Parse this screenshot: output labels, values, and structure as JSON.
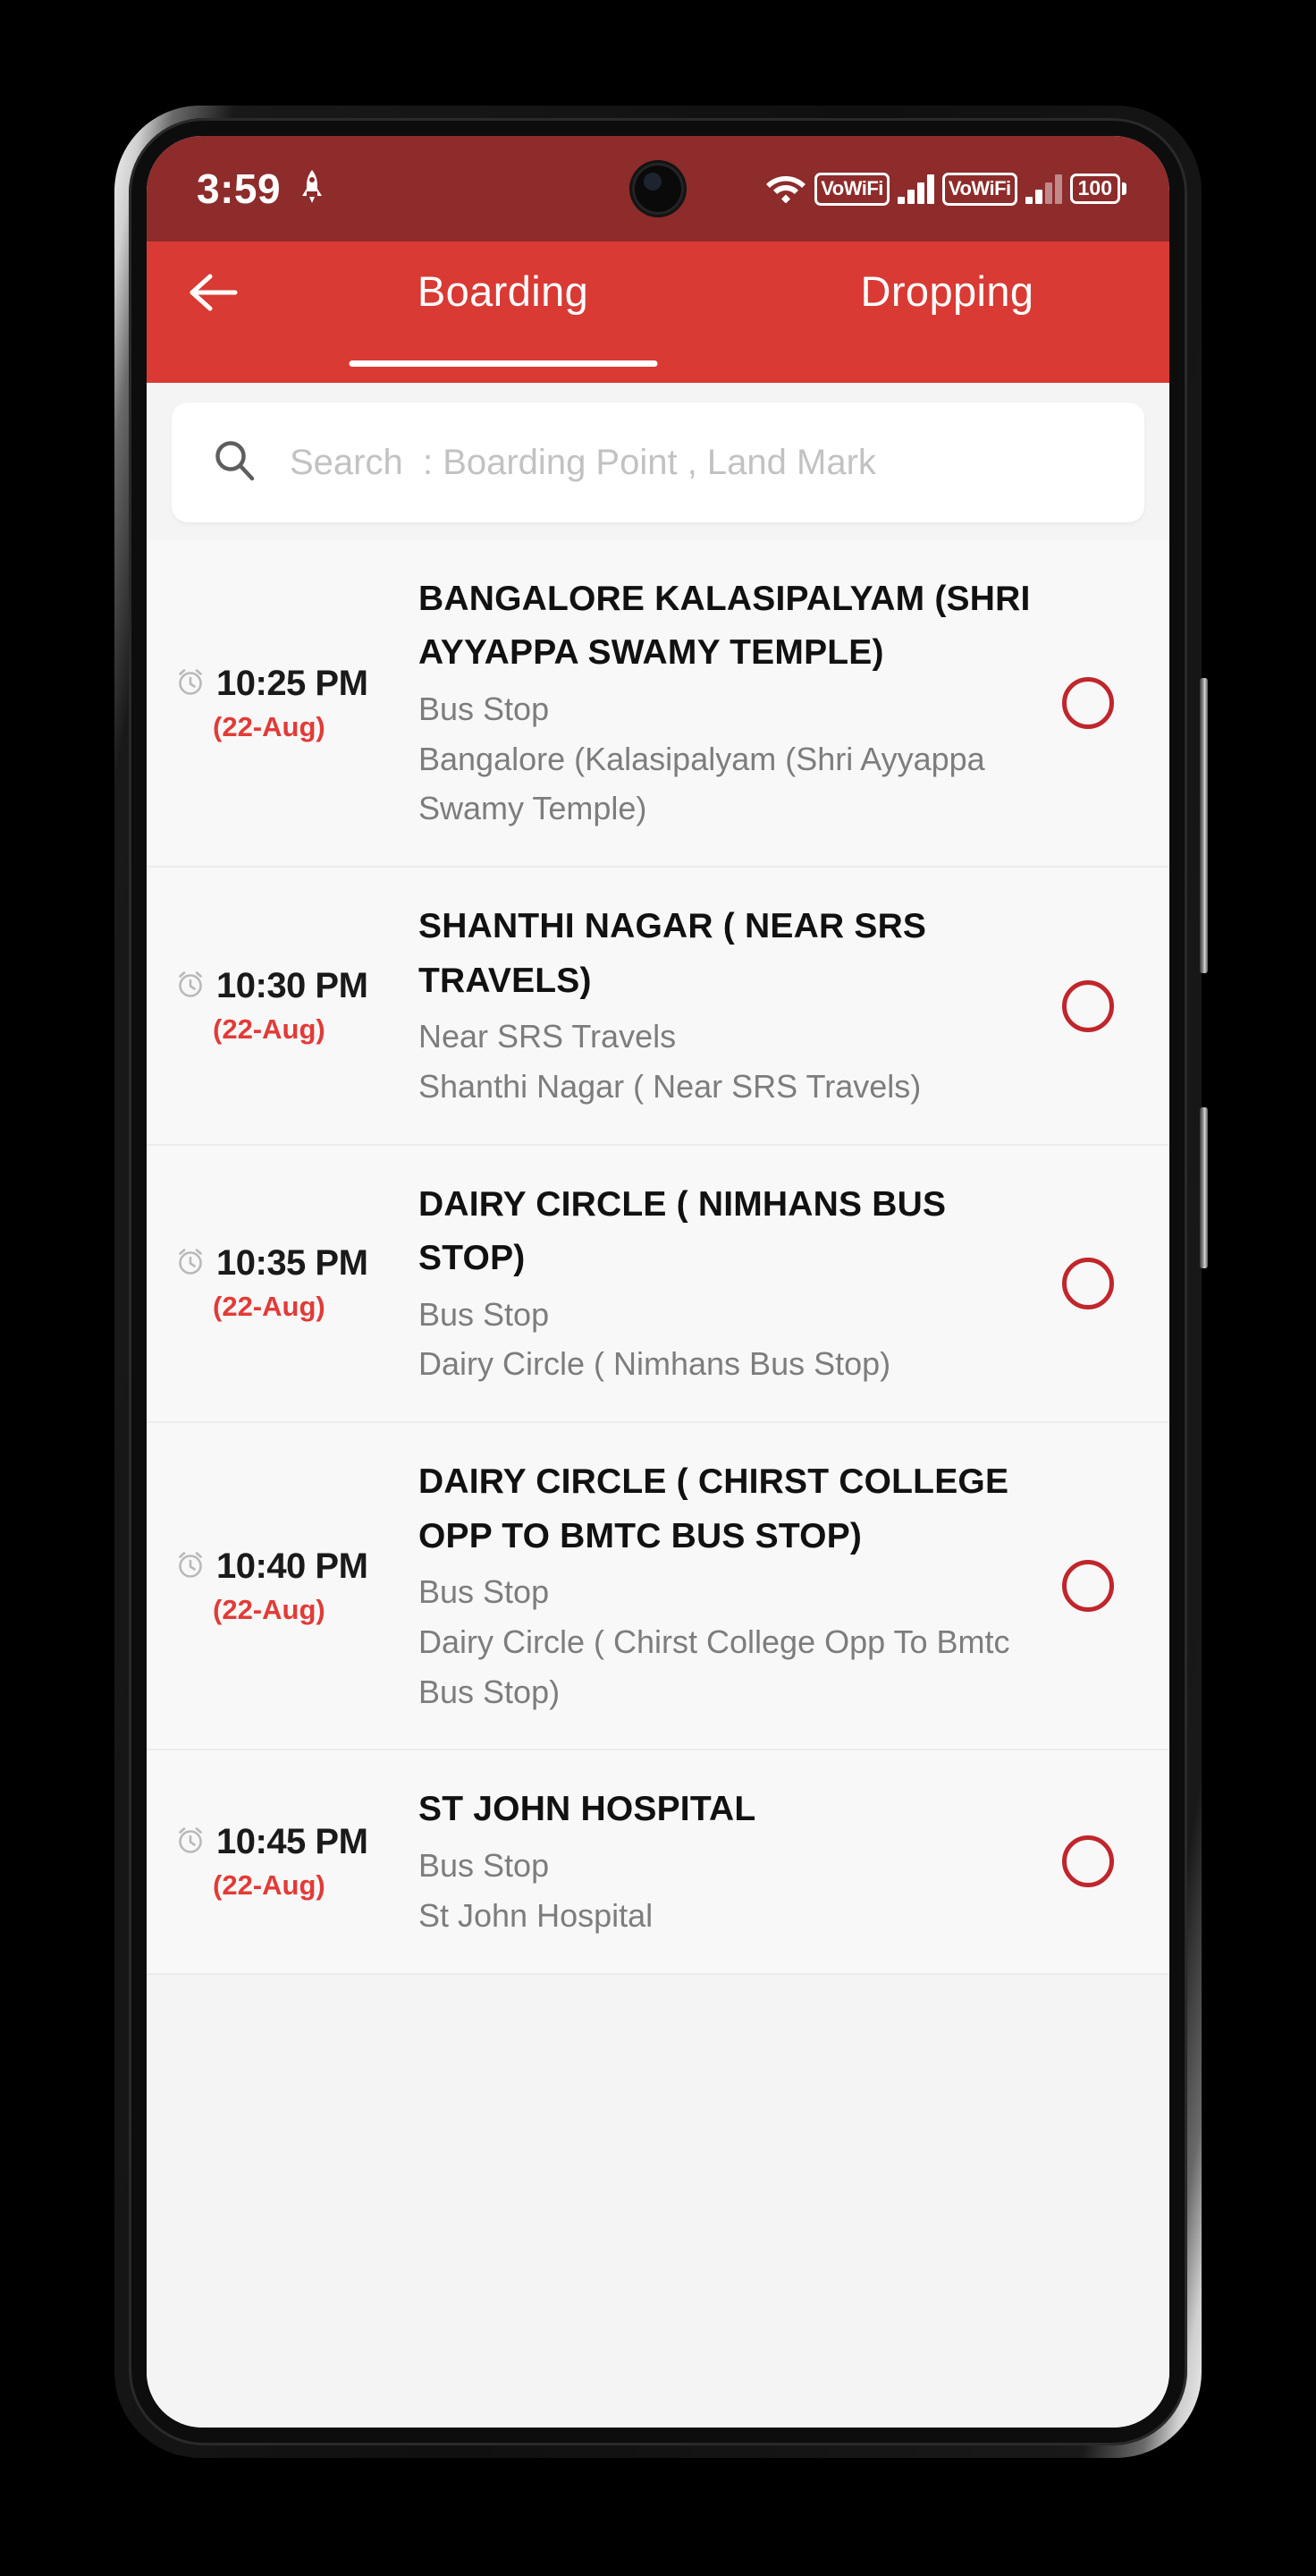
{
  "status_bar": {
    "clock": "3:59",
    "rocket_icon": "rocket-icon",
    "wifi_icon": "wifi-icon",
    "vowifi_badge_1": "VoWiFi",
    "vowifi_badge_2": "VoWiFi",
    "signal_icon_1": "signal-bars-icon",
    "signal_icon_2": "signal-bars-icon",
    "battery_level": "100",
    "background_color": "#8E2B2B"
  },
  "app_bar": {
    "back_icon": "back-arrow-icon",
    "background_color": "#D93A34",
    "tabs": [
      {
        "label": "Boarding",
        "active": true
      },
      {
        "label": "Dropping",
        "active": false
      }
    ]
  },
  "search": {
    "icon": "search-icon",
    "placeholder": "Search  : Boarding Point , Land Mark",
    "value": ""
  },
  "list": {
    "items": [
      {
        "alarm_icon": "alarm-clock-icon",
        "time": "10:25 PM",
        "date": "(22-Aug)",
        "title": "BANGALORE KALASIPALYAM (SHRI AYYAPPA SWAMY TEMPLE)",
        "subtitle": "Bus Stop",
        "landmark": "Bangalore (Kalasipalyam (Shri Ayyappa Swamy Temple)",
        "selected": false
      },
      {
        "alarm_icon": "alarm-clock-icon",
        "time": "10:30 PM",
        "date": "(22-Aug)",
        "title": "SHANTHI NAGAR ( NEAR SRS TRAVELS)",
        "subtitle": "Near SRS Travels",
        "landmark": "Shanthi Nagar ( Near SRS Travels)",
        "selected": false
      },
      {
        "alarm_icon": "alarm-clock-icon",
        "time": "10:35 PM",
        "date": "(22-Aug)",
        "title": "DAIRY CIRCLE ( NIMHANS BUS STOP)",
        "subtitle": "Bus Stop",
        "landmark": "Dairy Circle ( Nimhans Bus Stop)",
        "selected": false
      },
      {
        "alarm_icon": "alarm-clock-icon",
        "time": "10:40 PM",
        "date": "(22-Aug)",
        "title": "DAIRY CIRCLE ( CHIRST COLLEGE OPP TO BMTC BUS STOP)",
        "subtitle": "Bus Stop",
        "landmark": "Dairy Circle ( Chirst College Opp To Bmtc Bus Stop)",
        "selected": false
      },
      {
        "alarm_icon": "alarm-clock-icon",
        "time": "10:45 PM",
        "date": "(22-Aug)",
        "title": "ST JOHN HOSPITAL",
        "subtitle": "Bus Stop",
        "landmark": "St John Hospital",
        "selected": false
      }
    ]
  },
  "nav_bar": {
    "gesture_pill": "home-gesture-pill"
  },
  "colors": {
    "status_red": "#8E2B2B",
    "brand_red": "#D93A34",
    "accent_red": "#E23B37",
    "radio_outline": "#C0262B",
    "page_bg": "#F4F4F4"
  }
}
